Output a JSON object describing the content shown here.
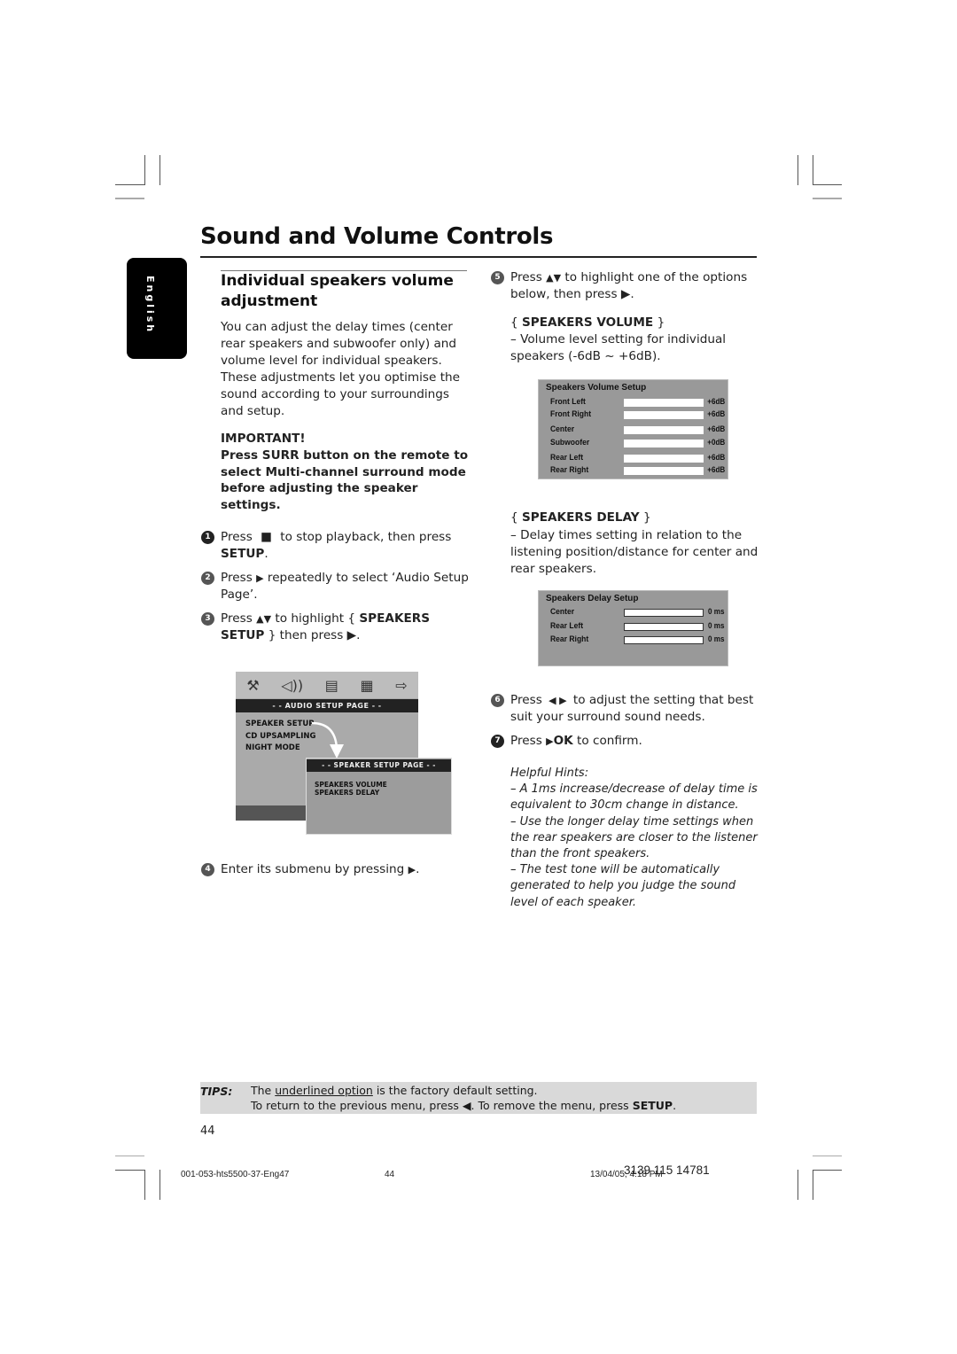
{
  "page": {
    "title": "Sound and Volume Controls",
    "language_tab": "English",
    "page_number": "44"
  },
  "section": {
    "title": "Individual speakers volume adjustment",
    "intro": "You can adjust the delay times (center rear speakers and subwoofer only) and volume level for individual speakers. These adjustments let you optimise the sound according to your surroundings and setup.",
    "important_label": "IMPORTANT!",
    "important_text": "Press SURR button on the remote to select Multi-channel surround mode before adjusting the speaker settings."
  },
  "steps": [
    {
      "num": "1",
      "pre": "Press",
      "icon": "stop-icon",
      "glyph": "■",
      "mid": "to stop playback, then press",
      "bold": "SETUP",
      "post": "."
    },
    {
      "num": "2",
      "pre": "Press",
      "glyph": "▶",
      "mid": "repeatedly to select ‘Audio Setup Page’.",
      "bold": "",
      "post": ""
    },
    {
      "num": "3",
      "pre": "Press",
      "glyph": "▲▼",
      "mid": "to highlight {",
      "bold": "SPEAKERS SETUP",
      "post": "} then press ▶."
    },
    {
      "num": "4",
      "pre": "Enter its submenu by pressing",
      "glyph": "▶",
      "mid": ".",
      "bold": "",
      "post": ""
    },
    {
      "num": "5",
      "pre": "Press",
      "glyph": "▲▼",
      "mid": "to highlight one of the options below, then press ▶.",
      "bold": "",
      "post": ""
    },
    {
      "num": "6",
      "pre": "Press",
      "glyph": "◀ ▶",
      "mid": "to adjust the setting that best suit your surround sound needs.",
      "bold": "",
      "post": ""
    },
    {
      "num": "7",
      "pre": "Press",
      "glyph": "▶",
      "bold": "OK",
      "mid": "to confirm.",
      "post": ""
    }
  ],
  "osd_menu": {
    "icons": [
      "tools-icon",
      "speaker-icon",
      "film-icon",
      "grid-check-icon",
      "exit-icon"
    ],
    "icon_glyphs": [
      "⚒",
      "🔈",
      "▤",
      "▦",
      "⇨"
    ],
    "header": "- -  AUDIO  SETUP  PAGE  - -",
    "items": [
      "SPEAKER SETUP",
      "CD UPSAMPLING",
      "NIGHT MODE"
    ],
    "submenu_header": "- - SPEAKER SETUP PAGE - -",
    "submenu_items": [
      "SPEAKERS VOLUME",
      "SPEAKERS DELAY"
    ]
  },
  "options": {
    "volume": {
      "heading_open": "{",
      "heading": "SPEAKERS VOLUME",
      "heading_close": "}",
      "desc": "–  Volume level setting for individual speakers (-6dB ~ +6dB)."
    },
    "delay": {
      "heading_open": "{",
      "heading": "SPEAKERS DELAY",
      "heading_close": "}",
      "desc": "–  Delay times setting in relation to the listening position/distance for center and rear speakers."
    }
  },
  "volume_setup": {
    "title": "Speakers Volume Setup",
    "rows": [
      {
        "label": "Front Left",
        "value": "+6dB"
      },
      {
        "label": "Front Right",
        "value": "+6dB"
      },
      {
        "label": "Center",
        "value": "+6dB"
      },
      {
        "label": "Subwoofer",
        "value": "+0dB"
      },
      {
        "label": "Rear Left",
        "value": "+6dB"
      },
      {
        "label": "Rear Right",
        "value": "+6dB"
      }
    ]
  },
  "delay_setup": {
    "title": "Speakers Delay Setup",
    "rows": [
      {
        "label": "Center",
        "value": "0 ms"
      },
      {
        "label": "Rear Left",
        "value": "0 ms"
      },
      {
        "label": "Rear Right",
        "value": "0 ms"
      }
    ]
  },
  "hints": {
    "title": "Helpful Hints:",
    "items": [
      "–  A 1ms increase/decrease of delay time is equivalent to 30cm change in distance.",
      "–  Use the longer delay time settings when the rear speakers are closer to the listener than the front speakers.",
      "–  The test tone will be automatically generated to help you judge the sound level of each speaker."
    ]
  },
  "tips": {
    "label": "TIPS:",
    "line1_pre": "The",
    "line1_underlined": "underlined option",
    "line1_post": "is the factory default setting.",
    "line2_pre": "To return to the previous menu, press ◀.  To remove the menu, press",
    "line2_bold": "SETUP",
    "line2_post": "."
  },
  "footer": {
    "file": "001-053-hts5500-37-Eng47",
    "page": "44",
    "timestamp": "13/04/05, 4:18 PM",
    "code": "3139 115 14781"
  }
}
